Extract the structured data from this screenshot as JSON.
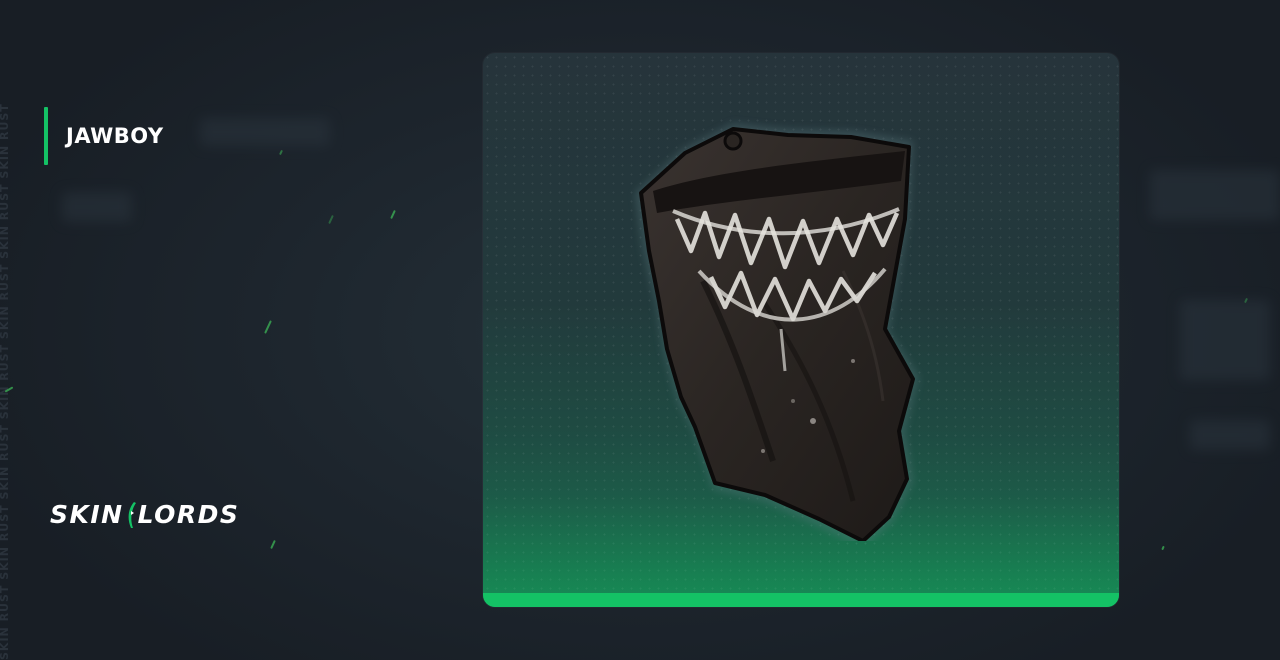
{
  "item": {
    "name": "JAWBOY",
    "image_icon": "bandana-mask-image"
  },
  "brand": {
    "logo_text_left": "SKIN",
    "logo_text_right": "LORDS",
    "side_watermark": "SKIN RUST SKIN RUST SKIN RUST SKIN RUST SKIN RUST SKIN RUST SKIN RUST"
  },
  "colors": {
    "accent": "#14c265",
    "background": "#1c232b",
    "card_top": "#26343b",
    "card_bottom": "#168452"
  }
}
